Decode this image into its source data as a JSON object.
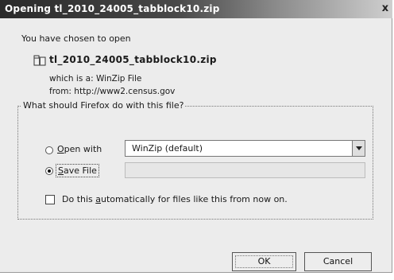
{
  "window": {
    "title": "Opening tl_2010_24005_tabblock10.zip",
    "close_glyph": "x"
  },
  "dialog": {
    "intro_text": "You have chosen to open",
    "file_name": "tl_2010_24005_tabblock10.zip",
    "which_is": "which is a:  WinZip File",
    "from": "from: http://www2.census.gov"
  },
  "action_group": {
    "legend": "What should Firefox do with this file?",
    "open_with": {
      "label_underlined": "O",
      "label_rest": "pen with",
      "selected": false,
      "app_value": "WinZip (default)"
    },
    "save_file": {
      "label_underlined": "S",
      "label_rest": "ave File",
      "selected": true
    },
    "auto_checkbox": {
      "label_prefix": "Do this ",
      "label_underlined": "a",
      "label_rest": "utomatically for files like this from now on.",
      "checked": false
    }
  },
  "buttons": {
    "ok_label": "OK",
    "cancel_label": "Cancel"
  }
}
